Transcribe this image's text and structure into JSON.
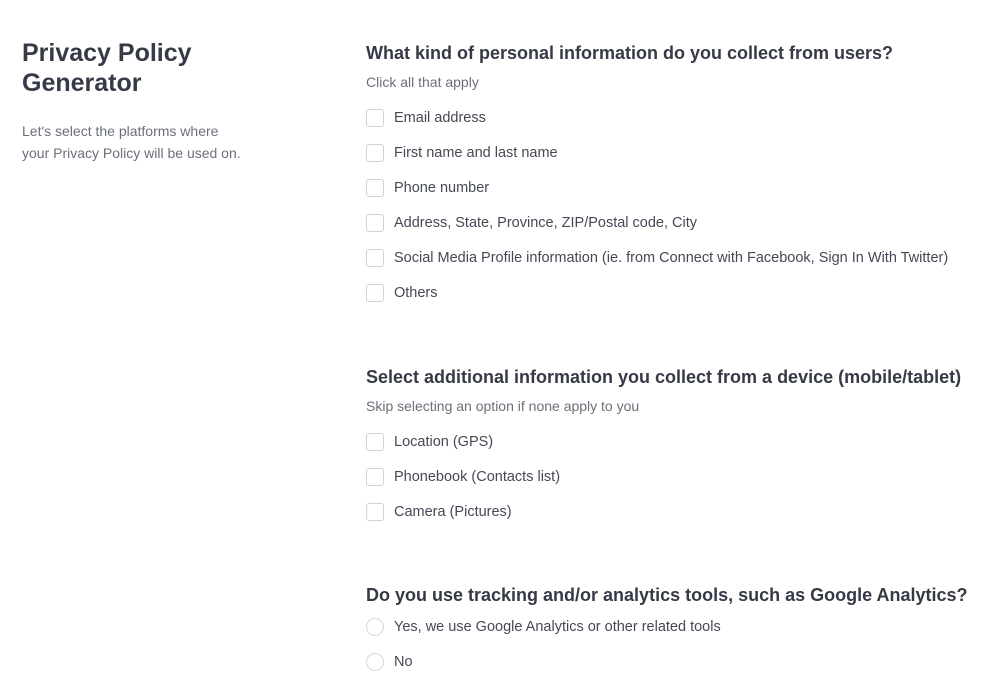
{
  "sidebar": {
    "title_line1": "Privacy Policy",
    "title_line2": "Generator",
    "desc_line1": "Let's select the platforms where",
    "desc_line2": "your Privacy Policy will be used on."
  },
  "q1": {
    "title": "What kind of personal information do you collect from users?",
    "subtitle": "Click all that apply",
    "options": [
      "Email address",
      "First name and last name",
      "Phone number",
      "Address, State, Province, ZIP/Postal code, City",
      "Social Media Profile information (ie. from Connect with Facebook, Sign In With Twitter)",
      "Others"
    ]
  },
  "q2": {
    "title": "Select additional information you collect from a device (mobile/tablet)",
    "subtitle": "Skip selecting an option if none apply to you",
    "options": [
      "Location (GPS)",
      "Phonebook (Contacts list)",
      "Camera (Pictures)"
    ]
  },
  "q3": {
    "title": "Do you use tracking and/or analytics tools, such as Google Analytics?",
    "options": [
      "Yes, we use Google Analytics or other related tools",
      "No"
    ]
  }
}
